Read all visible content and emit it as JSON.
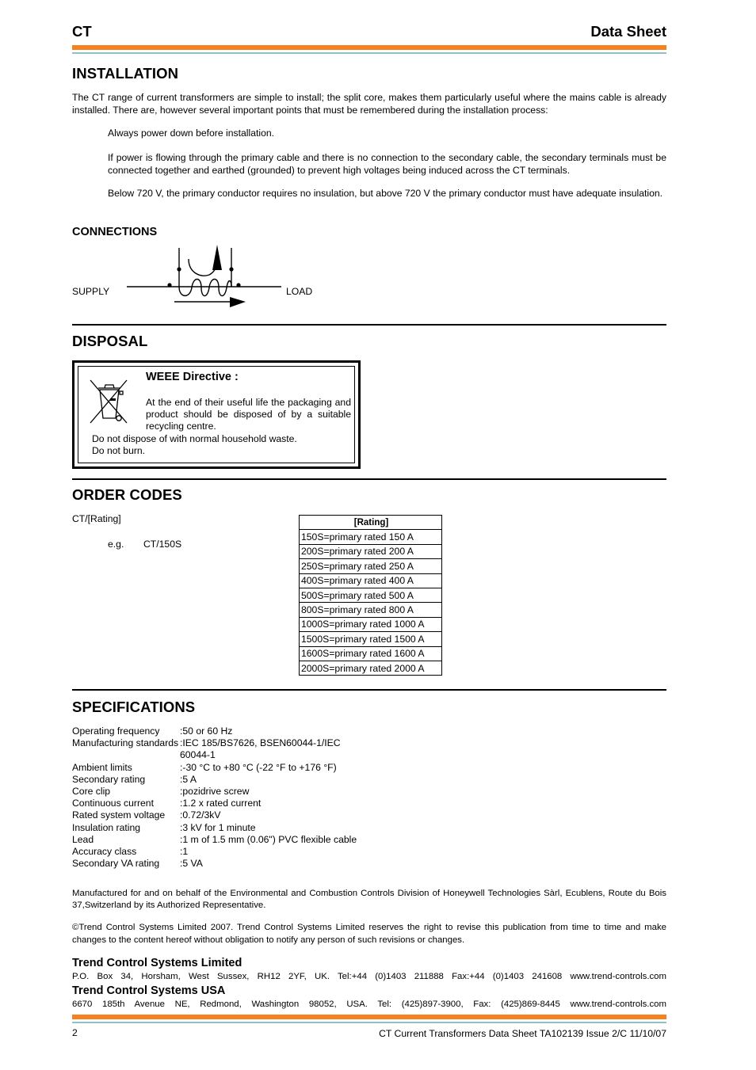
{
  "header": {
    "left": "CT",
    "right": "Data Sheet"
  },
  "installation": {
    "title": "INSTALLATION",
    "intro": "The CT range of current transformers are simple to install; the split core, makes them particularly useful where the mains cable is already installed. There are, however several important points that must be remembered during the installation process:",
    "points": [
      "Always  power  down  before  installation.",
      "If power is flowing through the primary cable and there is no connection to the secondary cable, the secondary terminals must be connected together and earthed (grounded) to prevent  high voltages being induced across the CT terminals.",
      "Below 720 V, the primary conductor requires no insulation, but above 720 V the primary conductor must have adequate insulation."
    ]
  },
  "connections": {
    "title": "CONNECTIONS",
    "supply_label": "SUPPLY",
    "load_label": "LOAD"
  },
  "disposal": {
    "title": "DISPOSAL",
    "icon": "crossed-out-wheelie-bin-icon",
    "weee_title": "WEEE Directive :",
    "weee_text": "At the end of their useful life the packaging and product should be disposed of by a suitable recycling centre.",
    "line1": "Do not dispose of with normal household waste.",
    "line2": "Do not burn."
  },
  "order_codes": {
    "title": "ORDER  CODES",
    "format": "CT/[Rating]",
    "example_label": "e.g.",
    "example_value": "CT/150S",
    "table_header": "[Rating]",
    "rows": [
      "150S=primary rated 150 A",
      "200S=primary rated 200 A",
      "250S=primary rated 250 A",
      "400S=primary rated 400 A",
      "500S=primary rated 500 A",
      "800S=primary rated 800 A",
      "1000S=primary rated 1000 A",
      "1500S=primary rated 1500 A",
      "1600S=primary rated 1600 A",
      "2000S=primary rated 2000 A"
    ]
  },
  "specifications": {
    "title": "SPECIFICATIONS",
    "items": [
      {
        "key": "Operating  frequency",
        "value": ":50 or 60 Hz"
      },
      {
        "key": "Manufacturing standards",
        "value": ":IEC  185/BS7626,  BSEN60044-1/IEC"
      },
      {
        "key": "",
        "value": "60044-1"
      },
      {
        "key": "Ambient limits",
        "value": ":-30 °C to +80 °C (-22 °F to +176 °F)"
      },
      {
        "key": "Secondary  rating",
        "value": ":5  A"
      },
      {
        "key": "Core clip",
        "value": ":pozidrive  screw"
      },
      {
        "key": "Continuous  current",
        "value": ":1.2  x  rated  current"
      },
      {
        "key": "Rated system voltage",
        "value": ":0.72/3kV"
      },
      {
        "key": "Insulation rating",
        "value": ":3 kV for 1 minute"
      },
      {
        "key": "Lead",
        "value": ":1 m of 1.5 mm (0.06\") PVC flexible cable"
      },
      {
        "key": "Accuracy  class",
        "value": ":1"
      },
      {
        "key": "Secondary  VA  rating",
        "value": ":5  VA"
      }
    ]
  },
  "legal": {
    "manufactured": "Manufactured for and on behalf of the Environmental and Combustion Controls Division of Honeywell Technologies Sàrl, Ecublens, Route du Bois 37,Switzerland by its Authorized Representative.",
    "copyright": "©Trend Control Systems Limited 2007. Trend Control Systems Limited reserves the right to revise this publication from time to time and make changes to the content hereof without obligation to notify any person of such revisions or changes."
  },
  "contacts": {
    "uk_name": "Trend Control Systems Limited",
    "uk_address": "P.O. Box 34, Horsham, West Sussex, RH12 2YF, UK. Tel:+44 (0)1403 211888 Fax:+44 (0)1403 241608 www.trend-controls.com",
    "usa_name": "Trend Control Systems USA",
    "usa_address": "6670 185th Avenue NE, Redmond, Washington 98052, USA. Tel: (425)897-3900, Fax: (425)869-8445 www.trend-controls.com"
  },
  "footer": {
    "page_number": "2",
    "doc_ref": "CT Current Transformers Data Sheet TA102139 Issue 2/C 11/10/07"
  },
  "colors": {
    "accent_orange": "#f5821f",
    "accent_blue": "#8fc1c7"
  }
}
